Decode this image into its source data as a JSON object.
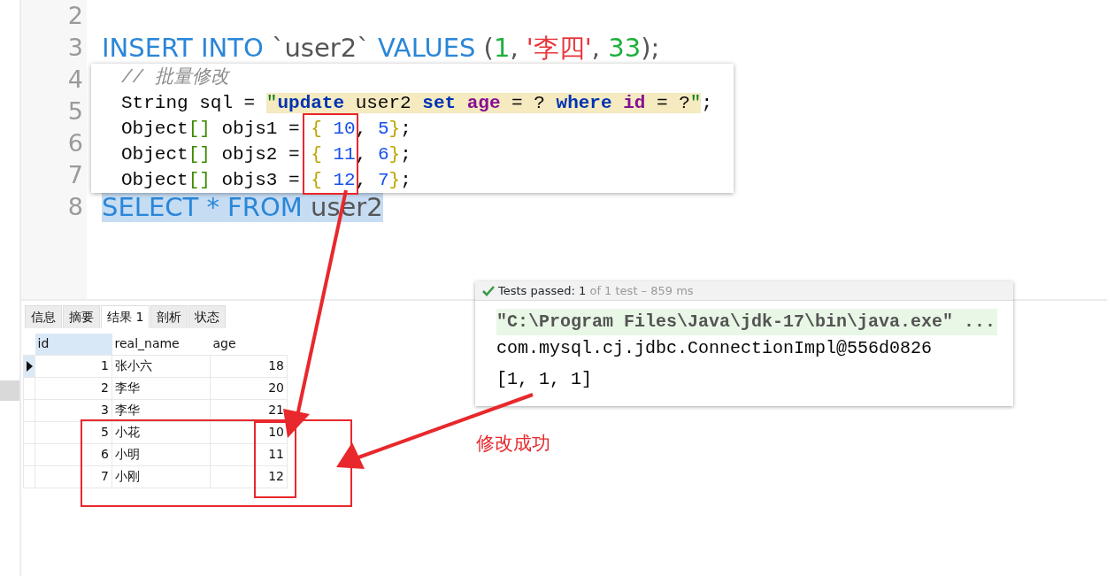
{
  "editor": {
    "lines": [
      {
        "number": "2",
        "selected": false
      },
      {
        "number": "3",
        "selected": false,
        "tokens": [
          {
            "kind": "keyword",
            "text": "INSERT INTO"
          },
          {
            "kind": "plain",
            "text": " `user2` "
          },
          {
            "kind": "keyword",
            "text": "VALUES"
          },
          {
            "kind": "plain",
            "text": " ("
          },
          {
            "kind": "number",
            "text": "1"
          },
          {
            "kind": "plain",
            "text": ", "
          },
          {
            "kind": "string",
            "text": "'李四'"
          },
          {
            "kind": "plain",
            "text": ", "
          },
          {
            "kind": "number",
            "text": "33"
          },
          {
            "kind": "plain",
            "text": ");"
          }
        ]
      },
      {
        "number": "4",
        "selected": false
      },
      {
        "number": "5",
        "selected": false
      },
      {
        "number": "6",
        "selected": false
      },
      {
        "number": "7",
        "selected": false
      },
      {
        "number": "8",
        "selected": true,
        "tokens": [
          {
            "kind": "keyword",
            "text": "SELECT * FROM "
          },
          {
            "kind": "plain",
            "text": " user2"
          }
        ]
      }
    ]
  },
  "code_popup": {
    "lines": [
      [
        {
          "kind": "comment",
          "text": "// 批量修改"
        }
      ],
      [
        {
          "kind": "plain",
          "text": "String sql = "
        },
        {
          "kind": "quote",
          "text": "\""
        },
        {
          "kind": "sql_keyword",
          "text": "update"
        },
        {
          "kind": "sql_text",
          "text": " user2 "
        },
        {
          "kind": "sql_keyword",
          "text": "set"
        },
        {
          "kind": "sql_column",
          "text": " age"
        },
        {
          "kind": "sql_text",
          "text": " = ? "
        },
        {
          "kind": "sql_keyword",
          "text": "where"
        },
        {
          "kind": "sql_column",
          "text": " id"
        },
        {
          "kind": "sql_text",
          "text": " = ?"
        },
        {
          "kind": "quote",
          "text": "\""
        },
        {
          "kind": "plain",
          "text": ";"
        }
      ],
      [
        {
          "kind": "plain",
          "text": "Object"
        },
        {
          "kind": "bracket",
          "text": "[]"
        },
        {
          "kind": "plain",
          "text": " objs1 = "
        },
        {
          "kind": "brace",
          "text": "{"
        },
        {
          "kind": "number",
          "text": " 10"
        },
        {
          "kind": "plain",
          "text": ", "
        },
        {
          "kind": "number",
          "text": "5"
        },
        {
          "kind": "brace",
          "text": "}"
        },
        {
          "kind": "plain",
          "text": ";"
        }
      ],
      [
        {
          "kind": "plain",
          "text": "Object"
        },
        {
          "kind": "bracket",
          "text": "[]"
        },
        {
          "kind": "plain",
          "text": " objs2 = "
        },
        {
          "kind": "brace",
          "text": "{"
        },
        {
          "kind": "number",
          "text": " 11"
        },
        {
          "kind": "plain",
          "text": ", "
        },
        {
          "kind": "number",
          "text": "6"
        },
        {
          "kind": "brace",
          "text": "}"
        },
        {
          "kind": "plain",
          "text": ";"
        }
      ],
      [
        {
          "kind": "plain",
          "text": "Object"
        },
        {
          "kind": "bracket",
          "text": "[]"
        },
        {
          "kind": "plain",
          "text": " objs3 = "
        },
        {
          "kind": "brace",
          "text": "{"
        },
        {
          "kind": "number",
          "text": " 12"
        },
        {
          "kind": "plain",
          "text": ", "
        },
        {
          "kind": "number",
          "text": "7"
        },
        {
          "kind": "brace",
          "text": "}"
        },
        {
          "kind": "plain",
          "text": ";"
        }
      ]
    ]
  },
  "result_tabs": [
    {
      "label": "信息",
      "selected": false
    },
    {
      "label": "摘要",
      "selected": false
    },
    {
      "label": "结果 1",
      "selected": true
    },
    {
      "label": "剖析",
      "selected": false
    },
    {
      "label": "状态",
      "selected": false
    }
  ],
  "table": {
    "columns": [
      "id",
      "real_name",
      "age"
    ],
    "rows": [
      {
        "selected": true,
        "cells": [
          "1",
          "张小六",
          "18"
        ]
      },
      {
        "selected": false,
        "cells": [
          "2",
          "李华",
          "20"
        ]
      },
      {
        "selected": false,
        "cells": [
          "3",
          "李华",
          "21"
        ]
      },
      {
        "selected": false,
        "cells": [
          "5",
          "小花",
          "10"
        ]
      },
      {
        "selected": false,
        "cells": [
          "6",
          "小明",
          "11"
        ]
      },
      {
        "selected": false,
        "cells": [
          "7",
          "小刚",
          "12"
        ]
      }
    ]
  },
  "test_panel": {
    "status": "Tests passed: 1",
    "summary": " of 1 test – 859 ms",
    "console": [
      {
        "kind": "command",
        "text": "\"C:\\Program Files\\Java\\jdk-17\\bin\\java.exe\" ..."
      },
      {
        "kind": "output",
        "text": "com.mysql.cj.jdbc.ConnectionImpl@556d0826"
      },
      {
        "kind": "output",
        "text": "[1, 1, 1]"
      }
    ]
  },
  "annotation": {
    "label": "修改成功"
  }
}
